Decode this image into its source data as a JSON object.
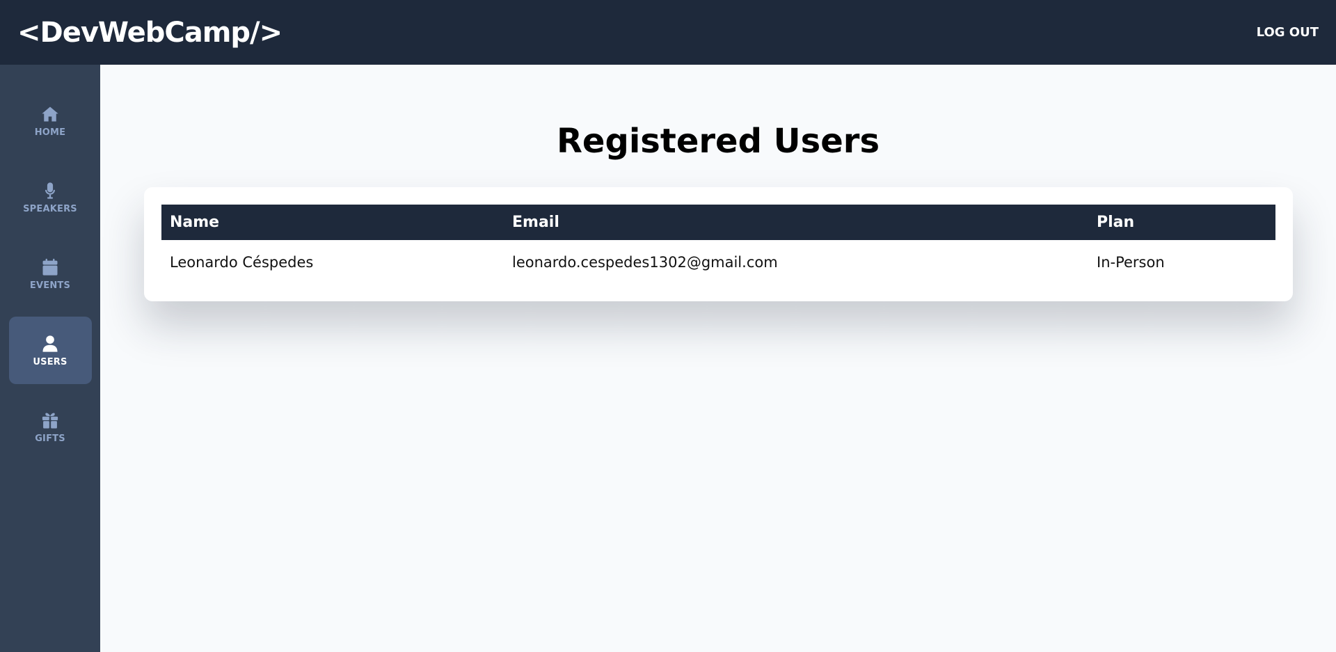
{
  "header": {
    "logo": "<DevWebCamp/>",
    "logout_label": "LOG OUT"
  },
  "sidebar": {
    "items": [
      {
        "label": "HOME",
        "icon": "home-icon",
        "active": false
      },
      {
        "label": "SPEAKERS",
        "icon": "microphone-icon",
        "active": false
      },
      {
        "label": "EVENTS",
        "icon": "calendar-icon",
        "active": false
      },
      {
        "label": "USERS",
        "icon": "user-icon",
        "active": true
      },
      {
        "label": "GIFTS",
        "icon": "gift-icon",
        "active": false
      }
    ]
  },
  "main": {
    "title": "Registered Users",
    "table": {
      "headers": [
        "Name",
        "Email",
        "Plan"
      ],
      "rows": [
        [
          "Leonardo Céspedes",
          "leonardo.cespedes1302@gmail.com",
          "In-Person"
        ]
      ]
    }
  },
  "colors": {
    "header_bg": "#1e293b",
    "sidebar_bg": "#334155",
    "active_item_bg": "#475a7a",
    "nav_text": "#8ea4c8",
    "page_bg": "#f8fafc"
  }
}
